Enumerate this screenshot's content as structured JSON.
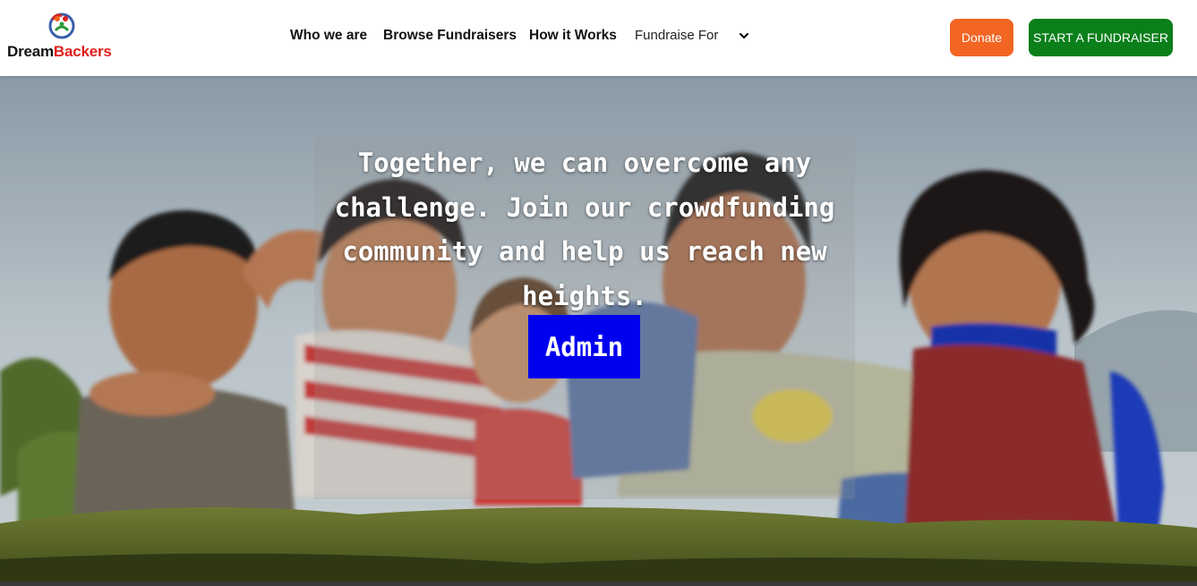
{
  "brand": {
    "name_part1": "Dream",
    "name_part2": "Backers",
    "accent_color": "#e0201b"
  },
  "nav": {
    "who_we_are": "Who we are",
    "browse_fundraisers": "Browse Fundraisers",
    "how_it_works": "How it Works",
    "fundraise_for": "Fundraise For",
    "dropdown_icon": "chevron-down-icon"
  },
  "actions": {
    "donate_label": "Donate",
    "donate_color": "#f26522",
    "start_label": "START A FUNDRAISER",
    "start_color": "#0a7f1a"
  },
  "hero": {
    "headline": "Together, we can overcome any challenge. Join our crowdfunding community and help us reach new heights.",
    "admin_label": "Admin",
    "admin_color": "#0000ee"
  }
}
